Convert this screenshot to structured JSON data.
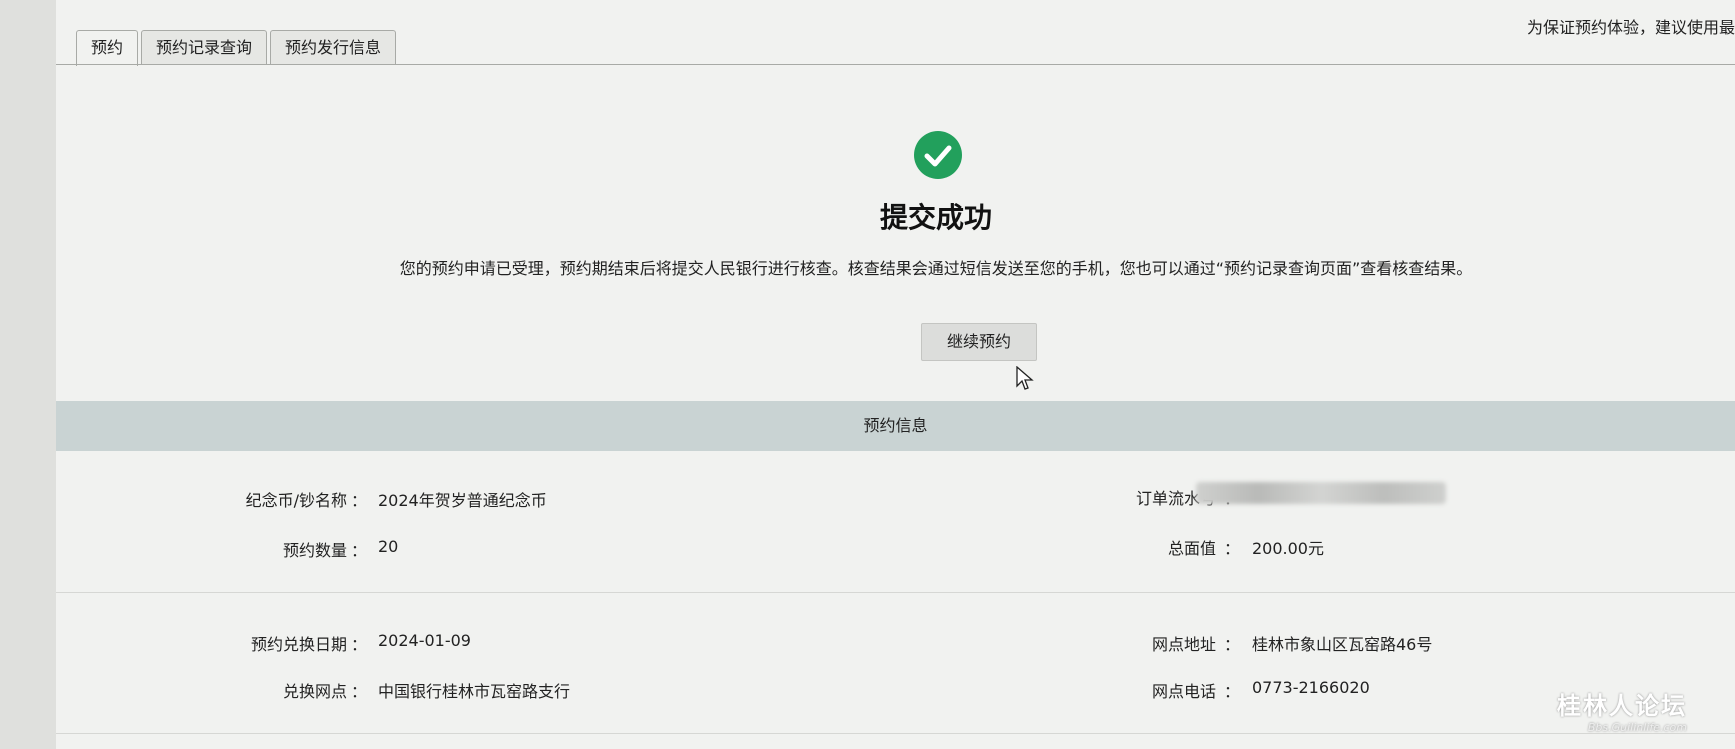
{
  "tabs": [
    {
      "label": "预约"
    },
    {
      "label": "预约记录查询"
    },
    {
      "label": "预约发行信息"
    }
  ],
  "top_notice": "为保证预约体验，建议使用最",
  "success": {
    "title": "提交成功",
    "message": "您的预约申请已受理，预约期结束后将提交人民银行进行核查。核查结果会通过短信发送至您的手机，您也可以通过“预约记录查询页面”查看核查结果。",
    "continue_label": "继续预约",
    "icon": "check-circle-icon",
    "icon_color": "#22a05c"
  },
  "info": {
    "section_title": "预约信息",
    "colon": "：",
    "coin_name_label": "纪念币/钞名称",
    "coin_name": "2024年贺岁普通纪念币",
    "order_no_label": "订单流水号",
    "quantity_label": "预约数量",
    "quantity": "20",
    "total_label": "总面值",
    "total": "200.00元",
    "date_label": "预约兑换日期",
    "date": "2024-01-09",
    "address_label": "网点地址",
    "address": "桂林市象山区瓦窑路46号",
    "branch_label": "兑换网点",
    "branch": "中国银行桂林市瓦窑路支行",
    "phone_label": "网点电话",
    "phone": "0773-2166020"
  },
  "watermark": {
    "main": "桂林人论坛",
    "sub": "Bbs.Guilinlife.com"
  }
}
